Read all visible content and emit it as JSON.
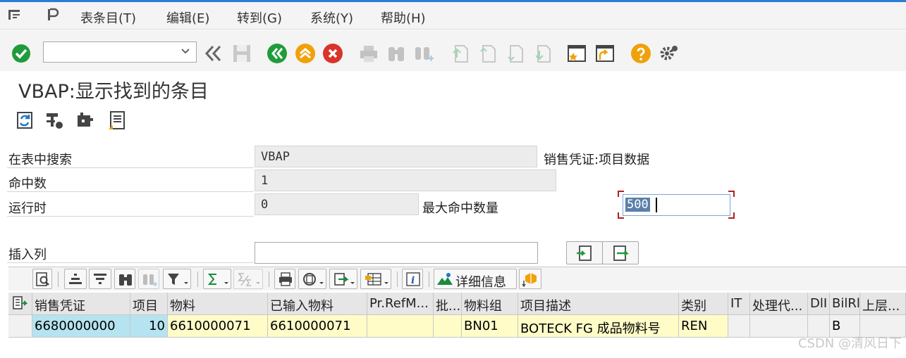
{
  "menu": [
    "表条目(T)",
    "编辑(E)",
    "转到(G)",
    "系统(Y)",
    "帮助(H)"
  ],
  "toolbar": {
    "command_value": ""
  },
  "page_title": "VBAP:显示找到的条目",
  "form": {
    "search_table_label": "在表中搜索",
    "search_table_value": "VBAP",
    "table_description": "销售凭证:项目数据",
    "hits_label": "命中数",
    "hits_value": "1",
    "runtime_label": "运行时",
    "runtime_value": "0",
    "max_hits_label": "最大命中数量",
    "max_hits_value": "500",
    "insert_column_label": "插入列",
    "insert_column_value": ""
  },
  "alv": {
    "detail_label": "详细信息"
  },
  "table": {
    "headers": [
      "销售凭证",
      "项目",
      "物料",
      "已输入物料",
      "Pr.RefM...",
      "批...",
      "物料组",
      "项目描述",
      "类别",
      "IT",
      "处理代...",
      "DlI",
      "BilRl",
      "上层..."
    ],
    "row": [
      "6680000000",
      "10",
      "6610000071",
      "6610000071",
      "",
      "",
      "BN01",
      "BOTECK FG 成品物料号",
      "REN",
      "",
      "",
      "",
      "B",
      ""
    ]
  },
  "watermark": "CSDN @清风日下",
  "colors": {
    "accent": "#2b7cd3",
    "key_cell": "#b5e3f0",
    "data_cell": "#fffcc8",
    "ok_green": "#1f9c3a",
    "cancel_red": "#d9342b",
    "exit_orange": "#f0a10a"
  }
}
